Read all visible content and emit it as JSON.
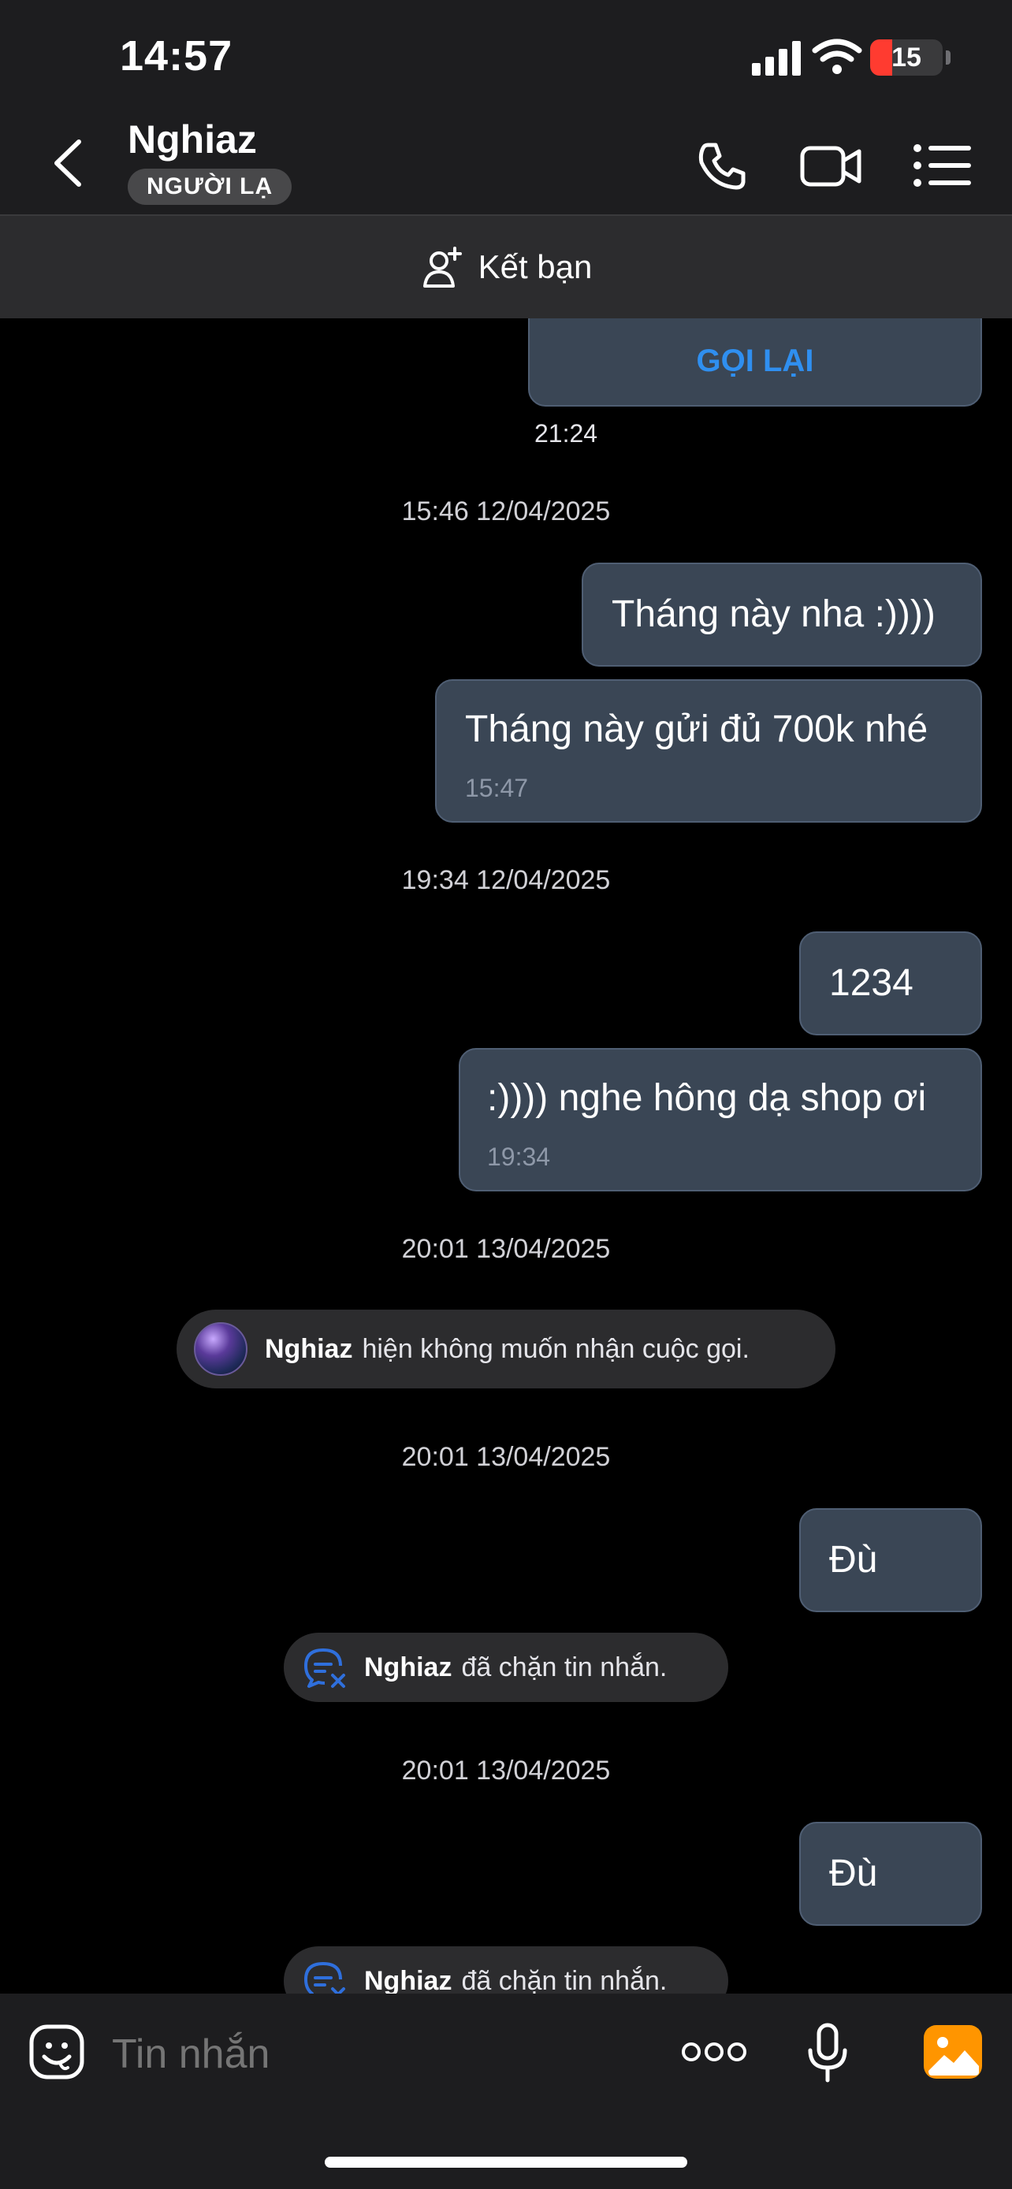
{
  "status_bar": {
    "time": "14:57",
    "battery_percent": 15
  },
  "header": {
    "contact_name": "Nghiaz",
    "badge": "NGƯỜI LẠ"
  },
  "add_friend": {
    "label": "Kết bạn"
  },
  "chat": {
    "call_card": {
      "button_label": "GỌI LẠI",
      "time": "21:24"
    },
    "items": [
      {
        "type": "timestamp",
        "text": "15:46 12/04/2025"
      },
      {
        "type": "message",
        "text": "Tháng này nha :))))"
      },
      {
        "type": "message",
        "text": "Tháng này gửi đủ 700k nhé",
        "time": "15:47"
      },
      {
        "type": "timestamp",
        "text": "19:34 12/04/2025"
      },
      {
        "type": "message",
        "text": "1234"
      },
      {
        "type": "message",
        "text": ":)))) nghe hông dạ shop ơi",
        "time": "19:34"
      },
      {
        "type": "timestamp",
        "text": "20:01 13/04/2025"
      },
      {
        "type": "system",
        "name": "Nghiaz",
        "text": "hiện không muốn nhận cuộc gọi."
      },
      {
        "type": "timestamp",
        "text": "20:01 13/04/2025"
      },
      {
        "type": "message",
        "text": "Đù"
      },
      {
        "type": "system",
        "name": "Nghiaz",
        "text": "đã chặn tin nhắn."
      },
      {
        "type": "timestamp",
        "text": "20:01 13/04/2025"
      },
      {
        "type": "message",
        "text": "Đù"
      },
      {
        "type": "system",
        "name": "Nghiaz",
        "text": "đã chặn tin nhắn."
      }
    ]
  },
  "input": {
    "placeholder": "Tin nhắn"
  },
  "colors": {
    "accent": "#2f8ff0",
    "bubble": "#3a4655",
    "battery_low": "#ff3b30",
    "gallery": "#ff9500"
  },
  "icons": [
    "back-chevron-icon",
    "phone-icon",
    "video-icon",
    "menu-list-icon",
    "add-friend-icon",
    "sticker-icon",
    "more-dots-icon",
    "microphone-icon",
    "gallery-icon",
    "blocked-message-icon"
  ]
}
